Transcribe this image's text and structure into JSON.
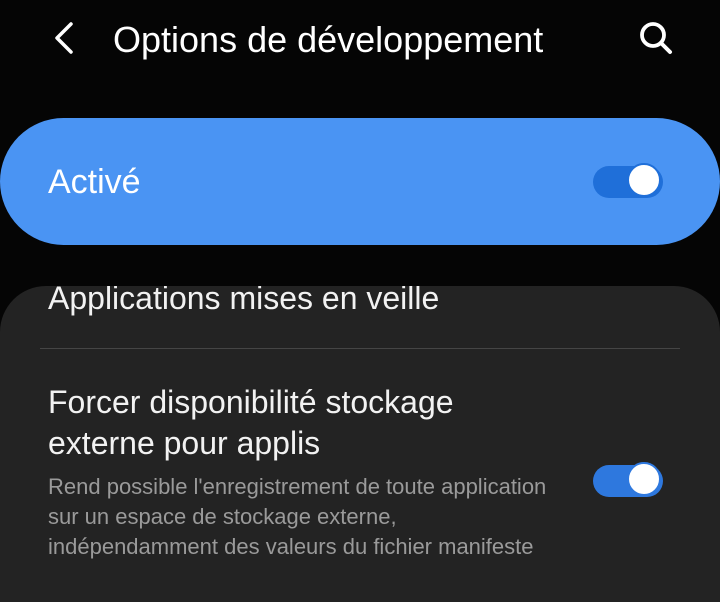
{
  "header": {
    "title": "Options de développement",
    "back_icon": "chevron-left-icon",
    "search_icon": "search-icon"
  },
  "master_switch": {
    "label": "Activé",
    "enabled": true,
    "background_color": "#4a94f3",
    "toggle_color": "#1f6fd9"
  },
  "settings": {
    "items": [
      {
        "title": "Applications mises en veille"
      },
      {
        "title": "Forcer disponibilité stockage externe pour applis",
        "description": "Rend possible l'enregistrement de toute application sur un espace de stockage externe, indépendamment des valeurs du fichier manifeste",
        "enabled": true
      }
    ]
  },
  "colors": {
    "background": "#050505",
    "panel": "#232323",
    "primary_text": "#f2f2f2",
    "secondary_text": "#9a9a9a",
    "accent": "#2e78de"
  }
}
